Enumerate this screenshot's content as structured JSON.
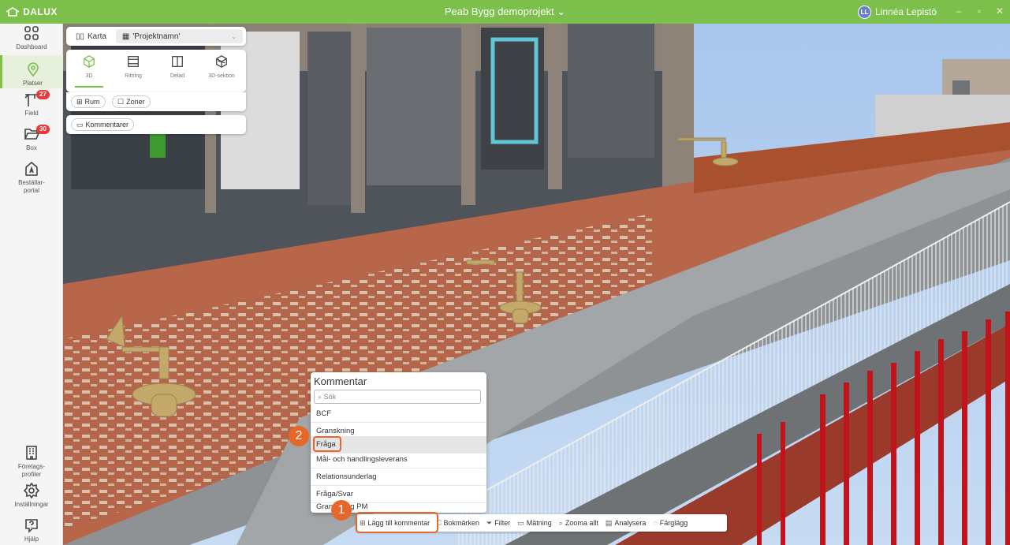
{
  "app": {
    "logo_text": "DALUX",
    "project_title": "Peab Bygg demoprojekt ⌄"
  },
  "user": {
    "initials": "LL",
    "name": "Linnéa Lepistö"
  },
  "window_controls": {
    "minimize": "–",
    "restore": "▫",
    "close": "✕"
  },
  "sidebar": {
    "items": [
      {
        "label": "Dashboard",
        "icon": "grid-icon",
        "active": false
      },
      {
        "label": "Platser",
        "icon": "location-pin-icon",
        "active": true
      },
      {
        "label": "Field",
        "icon": "crane-icon",
        "badge": "27"
      },
      {
        "label": "Box",
        "icon": "folder-icon",
        "badge": "30"
      },
      {
        "label_line1": "Beställar-",
        "label_line2": "portal",
        "icon": "portal-icon"
      }
    ],
    "bottom": [
      {
        "label_line1": "Företags-",
        "label_line2": "profiler",
        "icon": "building-icon"
      },
      {
        "label": "Inställningar",
        "icon": "gear-icon"
      },
      {
        "label": "Hjälp",
        "icon": "help-icon"
      }
    ]
  },
  "panel": {
    "tab_map": "Karta",
    "tab_project": "'Projektnamn'",
    "views": [
      "3D",
      "Ritning",
      "Delad",
      "3D-sektion"
    ],
    "selected_view": "3D",
    "pill_rooms": "Rum",
    "pill_zones": "Zoner",
    "pill_comments": "Kommentarer"
  },
  "comment_menu": {
    "header": "Kommentar",
    "search_placeholder": "Sök",
    "items": [
      "BCF",
      "Granskning",
      "Fråga",
      "Mål- och handlingsleverans",
      "Relationsunderlag",
      "Fråga/Svar",
      "Granskning PM"
    ],
    "highlighted": "Fråga"
  },
  "toolbar": {
    "items": [
      "Lägg till kommentar",
      "Bokmärken",
      "Filter",
      "Mätning",
      "Zooma allt",
      "Analysera",
      "Färglägg"
    ]
  },
  "steps": [
    "1",
    "2"
  ],
  "colors": {
    "brand_green": "#7cbf4a",
    "highlight_orange": "#e6672a",
    "badge_red": "#e53a3a"
  }
}
